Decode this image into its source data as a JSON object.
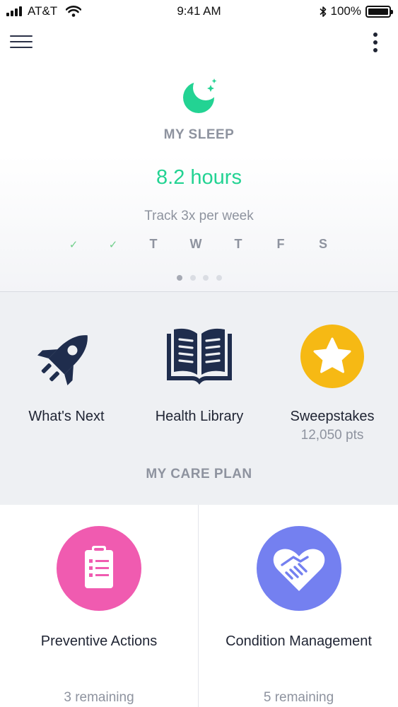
{
  "status_bar": {
    "carrier": "AT&T",
    "time": "9:41 AM",
    "battery": "100%"
  },
  "nav": {
    "menu_icon": "hamburger-menu-icon",
    "more_icon": "vertical-ellipsis-icon"
  },
  "sleep": {
    "icon": "moon-stars-icon",
    "title": "MY SLEEP",
    "hours": "8.2 hours",
    "track": "Track 3x per week",
    "days": [
      {
        "label": "✓",
        "done": true
      },
      {
        "label": "✓",
        "done": true
      },
      {
        "label": "T",
        "done": false
      },
      {
        "label": "W",
        "done": false
      },
      {
        "label": "T",
        "done": false
      },
      {
        "label": "F",
        "done": false
      },
      {
        "label": "S",
        "done": false
      }
    ],
    "pager": {
      "count": 4,
      "active_index": 0
    }
  },
  "quick_links": [
    {
      "label": "What's Next",
      "icon": "rocket-icon"
    },
    {
      "label": "Health Library",
      "icon": "open-book-icon"
    },
    {
      "label": "Sweepstakes",
      "sub": "12,050 pts",
      "icon": "star-icon"
    }
  ],
  "care_plan": {
    "title": "MY CARE PLAN",
    "items": [
      {
        "label": "Preventive Actions",
        "remaining": "3 remaining",
        "icon": "clipboard-icon",
        "color": "#f05bb0"
      },
      {
        "label": "Condition Management",
        "remaining": "5 remaining",
        "icon": "heart-handshake-icon",
        "color": "#7480f0"
      }
    ]
  },
  "colors": {
    "accent_green": "#23d393",
    "navy": "#1f2d4d",
    "star_yellow": "#f6b914",
    "muted": "#8e939f"
  }
}
